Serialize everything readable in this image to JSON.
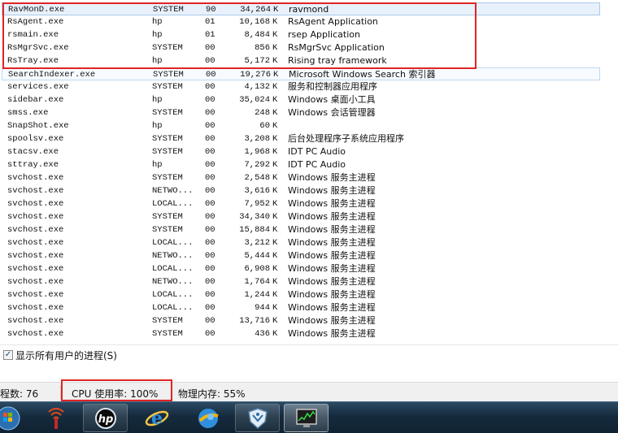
{
  "processes": [
    {
      "name": "RavMonD.exe",
      "user": "SYSTEM",
      "cpu": "90",
      "mem": "34,264",
      "unit": "K",
      "desc": "ravmond"
    },
    {
      "name": "RsAgent.exe",
      "user": "hp",
      "cpu": "01",
      "mem": "10,168",
      "unit": "K",
      "desc": "RsAgent Application"
    },
    {
      "name": "rsmain.exe",
      "user": "hp",
      "cpu": "01",
      "mem": "8,484",
      "unit": "K",
      "desc": "rsep Application"
    },
    {
      "name": "RsMgrSvc.exe",
      "user": "SYSTEM",
      "cpu": "00",
      "mem": "856",
      "unit": "K",
      "desc": "RsMgrSvc Application"
    },
    {
      "name": "RsTray.exe",
      "user": "hp",
      "cpu": "00",
      "mem": "5,172",
      "unit": "K",
      "desc": "Rising tray framework"
    },
    {
      "name": "SearchIndexer.exe",
      "user": "SYSTEM",
      "cpu": "00",
      "mem": "19,276",
      "unit": "K",
      "desc": "Microsoft Windows Search 索引器"
    },
    {
      "name": "services.exe",
      "user": "SYSTEM",
      "cpu": "00",
      "mem": "4,132",
      "unit": "K",
      "desc": "服务和控制器应用程序"
    },
    {
      "name": "sidebar.exe",
      "user": "hp",
      "cpu": "00",
      "mem": "35,024",
      "unit": "K",
      "desc": "Windows 桌面小工具"
    },
    {
      "name": "smss.exe",
      "user": "SYSTEM",
      "cpu": "00",
      "mem": "248",
      "unit": "K",
      "desc": "Windows 会话管理器"
    },
    {
      "name": "SnapShot.exe",
      "user": "hp",
      "cpu": "00",
      "mem": "60",
      "unit": "K",
      "desc": ""
    },
    {
      "name": "spoolsv.exe",
      "user": "SYSTEM",
      "cpu": "00",
      "mem": "3,208",
      "unit": "K",
      "desc": "后台处理程序子系统应用程序"
    },
    {
      "name": "stacsv.exe",
      "user": "SYSTEM",
      "cpu": "00",
      "mem": "1,968",
      "unit": "K",
      "desc": "IDT PC Audio"
    },
    {
      "name": "sttray.exe",
      "user": "hp",
      "cpu": "00",
      "mem": "7,292",
      "unit": "K",
      "desc": "IDT PC Audio"
    },
    {
      "name": "svchost.exe",
      "user": "SYSTEM",
      "cpu": "00",
      "mem": "2,548",
      "unit": "K",
      "desc": "Windows 服务主进程"
    },
    {
      "name": "svchost.exe",
      "user": "NETWO...",
      "cpu": "00",
      "mem": "3,616",
      "unit": "K",
      "desc": "Windows 服务主进程"
    },
    {
      "name": "svchost.exe",
      "user": "LOCAL...",
      "cpu": "00",
      "mem": "7,952",
      "unit": "K",
      "desc": "Windows 服务主进程"
    },
    {
      "name": "svchost.exe",
      "user": "SYSTEM",
      "cpu": "00",
      "mem": "34,340",
      "unit": "K",
      "desc": "Windows 服务主进程"
    },
    {
      "name": "svchost.exe",
      "user": "SYSTEM",
      "cpu": "00",
      "mem": "15,884",
      "unit": "K",
      "desc": "Windows 服务主进程"
    },
    {
      "name": "svchost.exe",
      "user": "LOCAL...",
      "cpu": "00",
      "mem": "3,212",
      "unit": "K",
      "desc": "Windows 服务主进程"
    },
    {
      "name": "svchost.exe",
      "user": "NETWO...",
      "cpu": "00",
      "mem": "5,444",
      "unit": "K",
      "desc": "Windows 服务主进程"
    },
    {
      "name": "svchost.exe",
      "user": "LOCAL...",
      "cpu": "00",
      "mem": "6,908",
      "unit": "K",
      "desc": "Windows 服务主进程"
    },
    {
      "name": "svchost.exe",
      "user": "NETWO...",
      "cpu": "00",
      "mem": "1,764",
      "unit": "K",
      "desc": "Windows 服务主进程"
    },
    {
      "name": "svchost.exe",
      "user": "LOCAL...",
      "cpu": "00",
      "mem": "1,244",
      "unit": "K",
      "desc": "Windows 服务主进程"
    },
    {
      "name": "svchost.exe",
      "user": "LOCAL...",
      "cpu": "00",
      "mem": "944",
      "unit": "K",
      "desc": "Windows 服务主进程"
    },
    {
      "name": "svchost.exe",
      "user": "SYSTEM",
      "cpu": "00",
      "mem": "13,716",
      "unit": "K",
      "desc": "Windows 服务主进程"
    },
    {
      "name": "svchost.exe",
      "user": "SYSTEM",
      "cpu": "00",
      "mem": "436",
      "unit": "K",
      "desc": "Windows 服务主进程"
    }
  ],
  "options": {
    "show_all_users_checked": true,
    "show_all_users_label": "显示所有用户的进程(S)",
    "check_glyph": "✓"
  },
  "status": {
    "process_count": "程数: 76",
    "cpu_usage": "CPU 使用率: 100%",
    "memory": "物理内存: 55%"
  },
  "taskbar": {
    "items": [
      {
        "icon": "windows-start-orb-icon"
      },
      {
        "icon": "wireless-signal-icon"
      },
      {
        "icon": "hp-logo-icon"
      },
      {
        "icon": "internet-explorer-icon"
      },
      {
        "icon": "globe-browser-icon"
      },
      {
        "icon": "rising-shield-icon"
      },
      {
        "icon": "task-manager-icon"
      }
    ]
  },
  "highlight_color": "#e02424"
}
